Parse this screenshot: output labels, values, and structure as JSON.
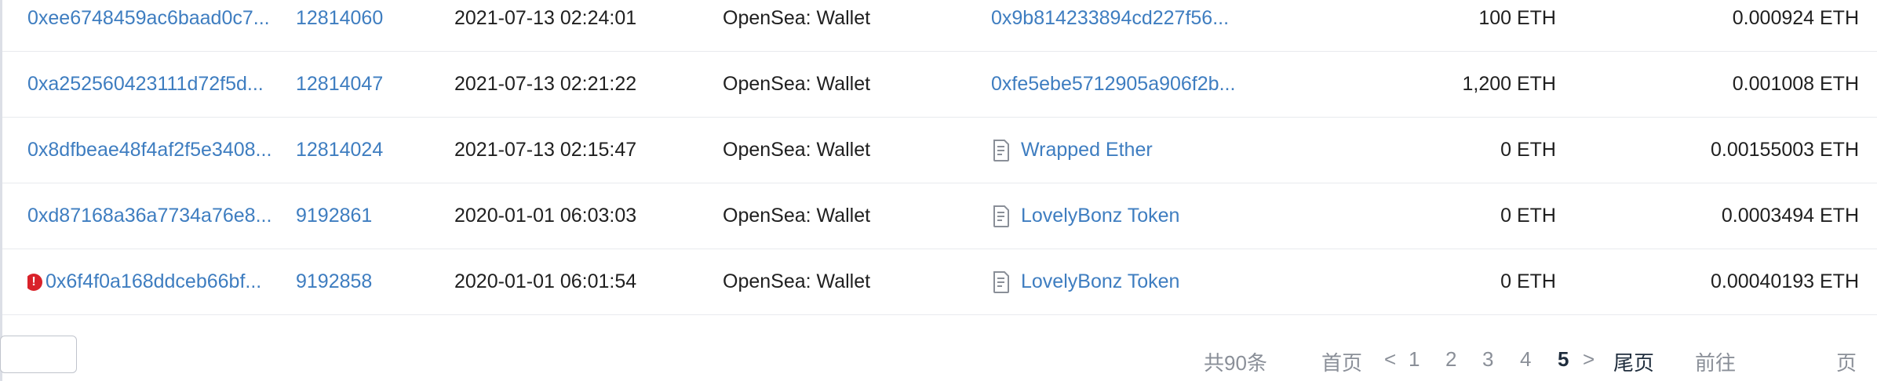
{
  "transactions": [
    {
      "hash": "0xee6748459ac6baad0c7...",
      "block": "12814060",
      "time": "2021-07-13 02:24:01",
      "from": "OpenSea: Wallet",
      "to": "0x9b814233894cd227f56...",
      "to_is_contract": false,
      "value": "100 ETH",
      "fee": "0.000924 ETH",
      "error": false
    },
    {
      "hash": "0xa252560423111d72f5d...",
      "block": "12814047",
      "time": "2021-07-13 02:21:22",
      "from": "OpenSea: Wallet",
      "to": "0xfe5ebe5712905a906f2b...",
      "to_is_contract": false,
      "value": "1,200 ETH",
      "fee": "0.001008 ETH",
      "error": false
    },
    {
      "hash": "0x8dfbeae48f4af2f5e3408...",
      "block": "12814024",
      "time": "2021-07-13 02:15:47",
      "from": "OpenSea: Wallet",
      "to": "Wrapped Ether",
      "to_is_contract": true,
      "value": "0 ETH",
      "fee": "0.00155003 ETH",
      "error": false
    },
    {
      "hash": "0xd87168a36a7734a76e8...",
      "block": "9192861",
      "time": "2020-01-01 06:03:03",
      "from": "OpenSea: Wallet",
      "to": "LovelyBonz Token",
      "to_is_contract": true,
      "value": "0 ETH",
      "fee": "0.0003494 ETH",
      "error": false
    },
    {
      "hash": "0x6f4f0a168ddceb66bf...",
      "block": "9192858",
      "time": "2020-01-01 06:01:54",
      "from": "OpenSea: Wallet",
      "to": "LovelyBonz Token",
      "to_is_contract": true,
      "value": "0 ETH",
      "fee": "0.00040193 ETH",
      "error": true
    }
  ],
  "pagination": {
    "total": "共90条",
    "first": "首页",
    "prev": "<",
    "pages": [
      "1",
      "2",
      "3",
      "4",
      "5"
    ],
    "current": "5",
    "next": ">",
    "last": "尾页",
    "goto": "前往",
    "goto_value": "",
    "page_suffix": "页"
  },
  "icons": {
    "error": "error-icon",
    "contract": "contract-document-icon"
  },
  "colors": {
    "link": "#3e7dc0",
    "error": "#d9222a",
    "text": "#1f1f1f",
    "muted": "#8a8f98",
    "border": "#e8eaee"
  }
}
